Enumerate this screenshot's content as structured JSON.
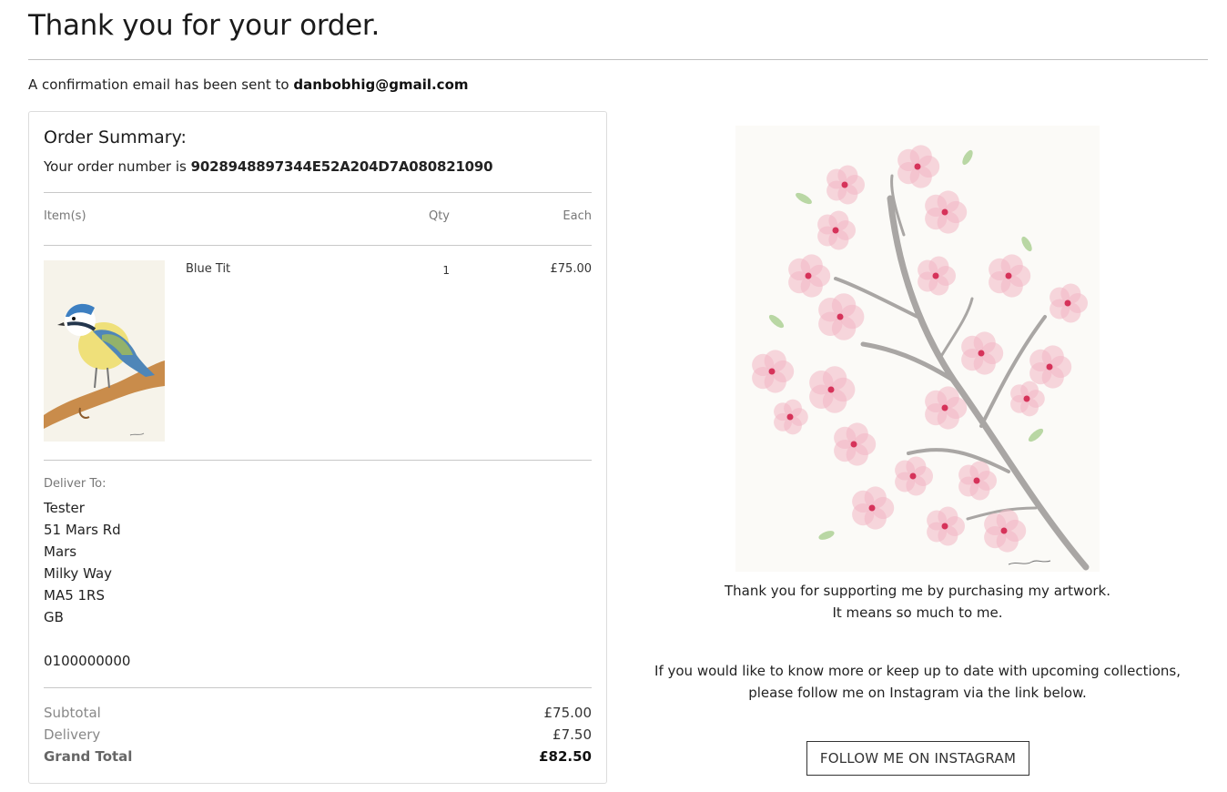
{
  "header": {
    "title": "Thank you for your order.",
    "confirm_prefix": "A confirmation email has been sent to",
    "email": "danbobhig@gmail.com"
  },
  "summary": {
    "title": "Order Summary:",
    "order_number_prefix": "Your order number is",
    "order_number": "9028948897344E52A204D7A080821090",
    "columns": {
      "items": "Item(s)",
      "qty": "Qty",
      "each": "Each"
    },
    "items": [
      {
        "name": "Blue Tit",
        "qty": "1",
        "each": "£75.00",
        "thumbnail": "blue-tit-painting"
      }
    ],
    "deliver_to": {
      "label": "Deliver To:",
      "name": "Tester",
      "street": "51 Mars Rd",
      "town": "Mars",
      "county": "Milky Way",
      "postcode": "MA5 1RS",
      "country": "GB",
      "phone": "0100000000"
    },
    "totals": {
      "subtotal_label": "Subtotal",
      "subtotal": "£75.00",
      "delivery_label": "Delivery",
      "delivery": "£7.50",
      "grand_total_label": "Grand Total",
      "grand_total": "£82.50"
    }
  },
  "aside": {
    "artwork": "cherry-blossom-painting",
    "thanks_line1": "Thank you for supporting me by purchasing my artwork.",
    "thanks_line2": "It means so much to me.",
    "follow_line1": "If you would like to know more or keep up to date with upcoming collections,",
    "follow_line2": "please follow me on Instagram via the link below.",
    "button_label": "FOLLOW ME ON INSTAGRAM"
  },
  "colors": {
    "blossom_pink": "#f2b6c4",
    "blossom_center": "#d6335a",
    "branch_grey": "#a9a6a4",
    "leaf_green": "#a9cf8f"
  }
}
